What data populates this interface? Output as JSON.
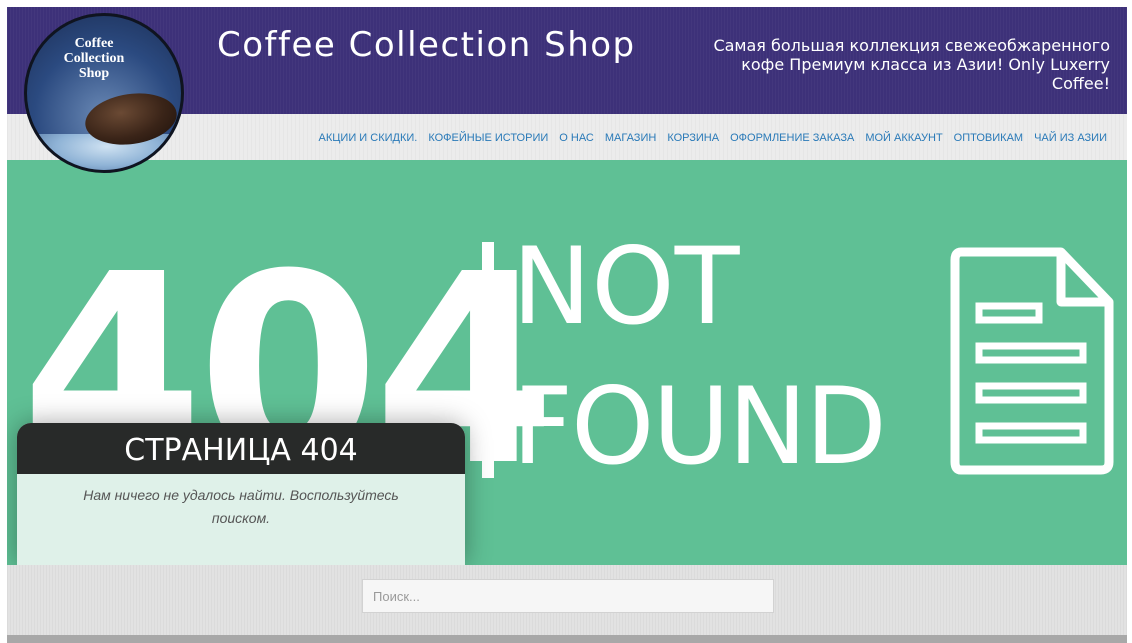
{
  "header": {
    "site_title": "Coffee Collection Shop",
    "tagline": "Самая большая коллекция свежеобжаренного кофе Премиум класса из Азии! Only Luxerry Coffee!"
  },
  "logo": {
    "line1": "Coffee",
    "line2": "Collection",
    "line3": "Shop"
  },
  "nav": {
    "items": [
      "АКЦИИ И СКИДКИ.",
      "КОФЕЙНЫЕ ИСТОРИИ",
      "О НАС",
      "МАГАЗИН",
      "КОРЗИНА",
      "ОФОРМЛЕНИЕ ЗАКАЗА",
      "МОЙ АККАУНТ",
      "ОПТОВИКАМ",
      "ЧАЙ ИЗ АЗИИ"
    ]
  },
  "hero": {
    "code": "404",
    "not": "NOT",
    "found": "FOUND"
  },
  "error_card": {
    "title": "СТРАНИЦА 404",
    "message": "Нам ничего не удалось найти. Воспользуйтесь поиском."
  },
  "search": {
    "placeholder": "Поиск..."
  },
  "colors": {
    "header_bg": "#3d3179",
    "hero_bg": "#5fc095",
    "nav_link": "#2a7ab8",
    "card_head_bg": "#282a29",
    "card_body_bg": "#dff1e9"
  },
  "icons": {
    "hero_document": "document-icon",
    "logo_image": "coffee-bean-logo"
  }
}
